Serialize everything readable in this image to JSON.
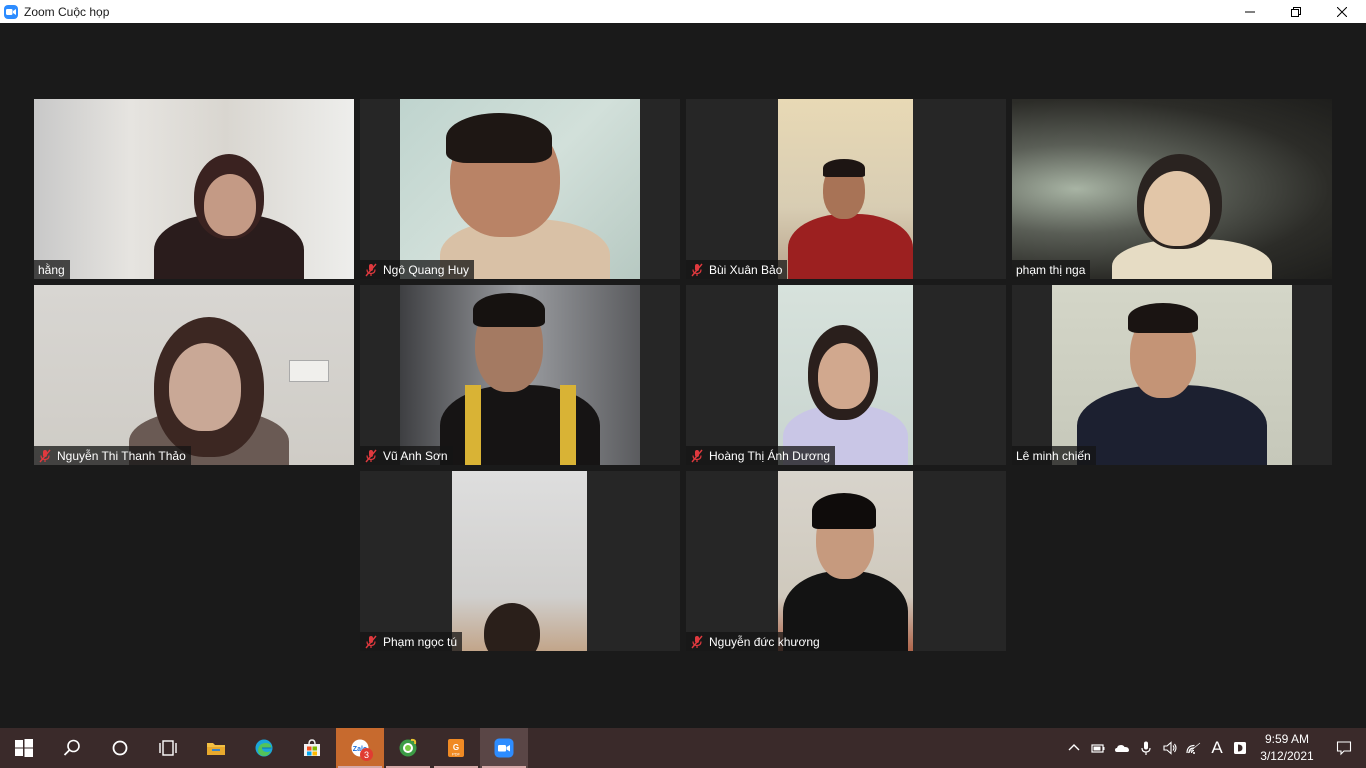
{
  "window": {
    "title": "Zoom Cuộc họp"
  },
  "participants": [
    {
      "name": "hằng",
      "muted": false
    },
    {
      "name": "Ngô Quang Huy",
      "muted": true
    },
    {
      "name": "Bùi Xuân Bảo",
      "muted": true
    },
    {
      "name": "phạm thị nga",
      "muted": false,
      "active_speaker": true
    },
    {
      "name": "Nguyễn Thi Thanh Thảo",
      "muted": true
    },
    {
      "name": "Vũ Anh Sơn",
      "muted": true
    },
    {
      "name": "Hoàng Thị Ánh Dương",
      "muted": true
    },
    {
      "name": "Lê minh chiến",
      "muted": false
    },
    {
      "name": "Phạm ngọc tú",
      "muted": true
    },
    {
      "name": "Nguyễn đức khương",
      "muted": true
    }
  ],
  "taskbar": {
    "apps": [
      "start-icon",
      "search-icon",
      "cortana-icon",
      "task-view-icon",
      "file-explorer-icon",
      "edge-icon",
      "store-icon",
      "zalo-icon",
      "coccoc-icon",
      "foxit-pdf-icon",
      "zoom-icon"
    ],
    "zalo_badge": "3",
    "input_indicator": "A",
    "time": "9:59 AM",
    "date": "3/12/2021"
  },
  "colors": {
    "active_speaker_border": "#d8e85a",
    "mute_icon": "#e0393e",
    "taskbar": "#3a2a2a",
    "zoom_blue": "#2d8cff"
  }
}
